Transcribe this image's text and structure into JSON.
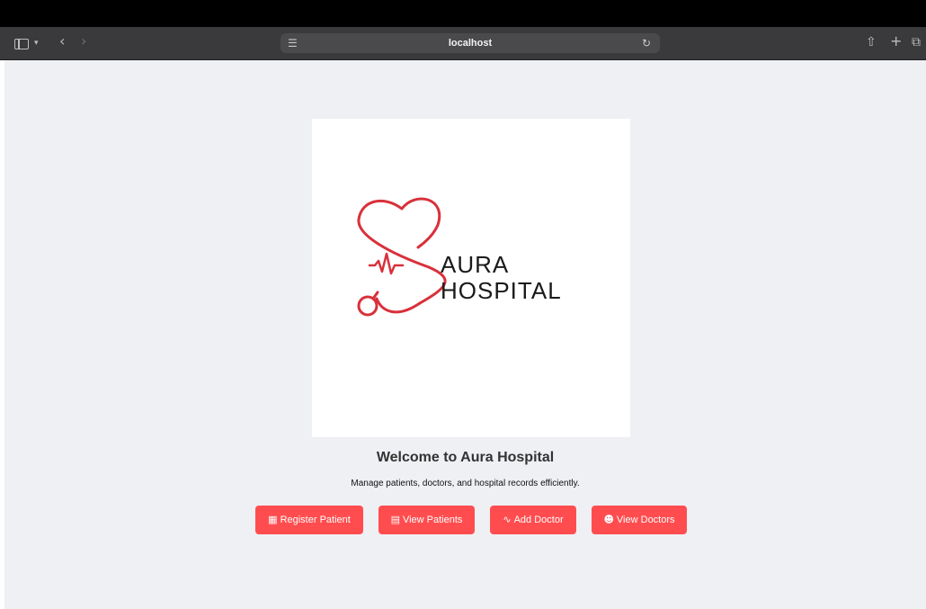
{
  "browser": {
    "address": "localhost",
    "icons": {
      "sidebar": "sidebar-toggle-icon",
      "chevron": "chevron-down-icon",
      "back": "back-arrow-icon",
      "forward": "forward-arrow-icon",
      "page": "page-icon",
      "reload": "reload-icon",
      "share": "share-icon",
      "new_tab": "plus-icon",
      "tabs": "tabs-overview-icon"
    }
  },
  "logo": {
    "line1": "AURA",
    "line2": "HOSPITAL",
    "accent_color": "#d9303a"
  },
  "main": {
    "welcome_title": "Welcome to Aura Hospital",
    "subtitle": "Manage patients, doctors, and hospital records efficiently.",
    "buttons": [
      {
        "icon": "register-icon",
        "label": "Register Patient"
      },
      {
        "icon": "document-icon",
        "label": "View Patients"
      },
      {
        "icon": "stethoscope-icon",
        "label": "Add Doctor"
      },
      {
        "icon": "doctor-icon",
        "label": "View Doctors"
      }
    ]
  },
  "colors": {
    "button_bg": "#ff4d4f",
    "page_bg": "#eff0f4"
  }
}
